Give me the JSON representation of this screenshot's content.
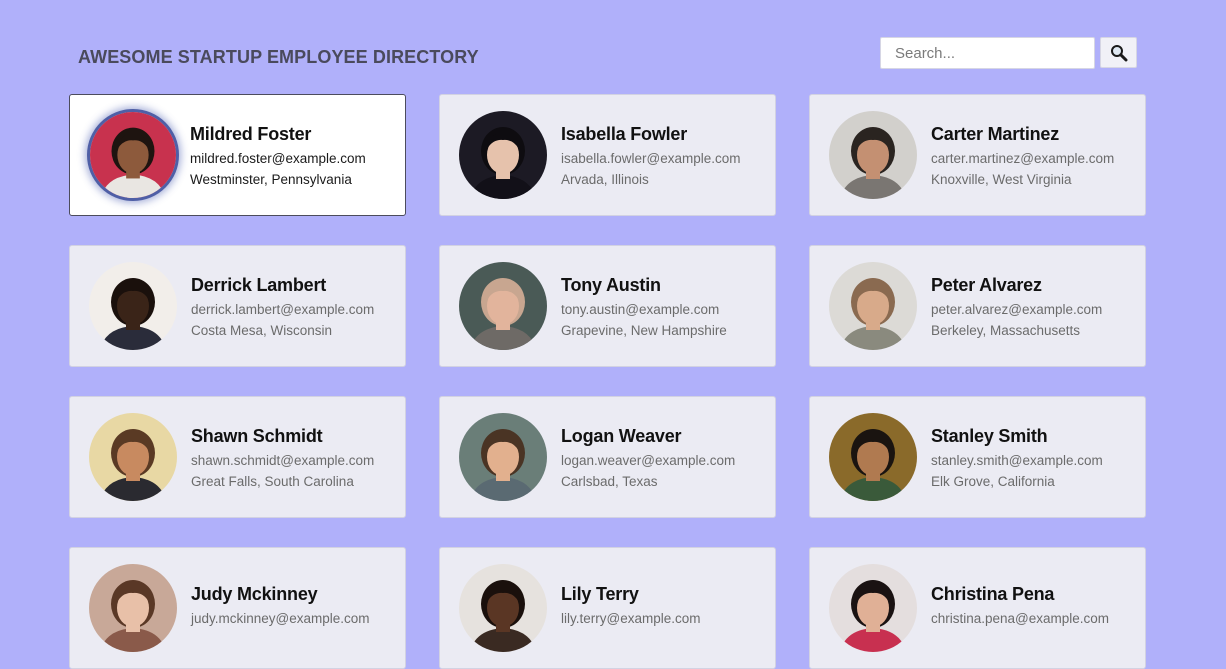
{
  "header": {
    "title": "AWESOME STARTUP EMPLOYEE DIRECTORY"
  },
  "search": {
    "placeholder": "Search...",
    "value": "",
    "button_icon": "search-icon"
  },
  "colors": {
    "background": "#b0b0fa",
    "card": "#ebebf3",
    "card_selected": "#ffffff"
  },
  "employees": [
    {
      "name": "Mildred Foster",
      "email": "mildred.foster@example.com",
      "location": "Westminster, Pennsylvania",
      "selected": true,
      "avatar": {
        "bg": "#c8324e",
        "skin": "#8d5a3c",
        "hair": "#1e1410",
        "shirt": "#e9e6e2"
      }
    },
    {
      "name": "Isabella Fowler",
      "email": "isabella.fowler@example.com",
      "location": "Arvada, Illinois",
      "selected": false,
      "avatar": {
        "bg": "#1c1a24",
        "skin": "#e6c2ac",
        "hair": "#0e0c10",
        "shirt": "#121018"
      }
    },
    {
      "name": "Carter Martinez",
      "email": "carter.martinez@example.com",
      "location": "Knoxville, West Virginia",
      "selected": false,
      "avatar": {
        "bg": "#d2d0cc",
        "skin": "#c49072",
        "hair": "#2a2420",
        "shirt": "#7a7672"
      }
    },
    {
      "name": "Derrick Lambert",
      "email": "derrick.lambert@example.com",
      "location": "Costa Mesa, Wisconsin",
      "selected": false,
      "avatar": {
        "bg": "#f2eeea",
        "skin": "#3a2418",
        "hair": "#1a100c",
        "shirt": "#2a2c3a"
      }
    },
    {
      "name": "Tony Austin",
      "email": "tony.austin@example.com",
      "location": "Grapevine, New Hampshire",
      "selected": false,
      "avatar": {
        "bg": "#4a5a56",
        "skin": "#e2b49c",
        "hair": "#c8a690",
        "shirt": "#6e6a66"
      }
    },
    {
      "name": "Peter Alvarez",
      "email": "peter.alvarez@example.com",
      "location": "Berkeley, Massachusetts",
      "selected": false,
      "avatar": {
        "bg": "#dcdad6",
        "skin": "#d8aa8a",
        "hair": "#8a6a50",
        "shirt": "#8a8a7e"
      }
    },
    {
      "name": "Shawn Schmidt",
      "email": "shawn.schmidt@example.com",
      "location": "Great Falls, South Carolina",
      "selected": false,
      "avatar": {
        "bg": "#e8d8a4",
        "skin": "#c88a60",
        "hair": "#5a3a24",
        "shirt": "#2a2a30"
      }
    },
    {
      "name": "Logan Weaver",
      "email": "logan.weaver@example.com",
      "location": "Carlsbad, Texas",
      "selected": false,
      "avatar": {
        "bg": "#6a7e78",
        "skin": "#e2b08e",
        "hair": "#4a3424",
        "shirt": "#5a6a72"
      }
    },
    {
      "name": "Stanley Smith",
      "email": "stanley.smith@example.com",
      "location": "Elk Grove, California",
      "selected": false,
      "avatar": {
        "bg": "#8a6a2a",
        "skin": "#b07a50",
        "hair": "#1a1410",
        "shirt": "#3a5a3a"
      }
    },
    {
      "name": "Judy Mckinney",
      "email": "judy.mckinney@example.com",
      "location": "",
      "selected": false,
      "avatar": {
        "bg": "#c8a898",
        "skin": "#e8c0a8",
        "hair": "#5a3826",
        "shirt": "#8a5a4a"
      }
    },
    {
      "name": "Lily Terry",
      "email": "lily.terry@example.com",
      "location": "",
      "selected": false,
      "avatar": {
        "bg": "#e6e2de",
        "skin": "#5a3624",
        "hair": "#1a100c",
        "shirt": "#3a2a22"
      }
    },
    {
      "name": "Christina Pena",
      "email": "christina.pena@example.com",
      "location": "",
      "selected": false,
      "avatar": {
        "bg": "#e4dede",
        "skin": "#e0b096",
        "hair": "#1a1212",
        "shirt": "#c83050"
      }
    }
  ]
}
